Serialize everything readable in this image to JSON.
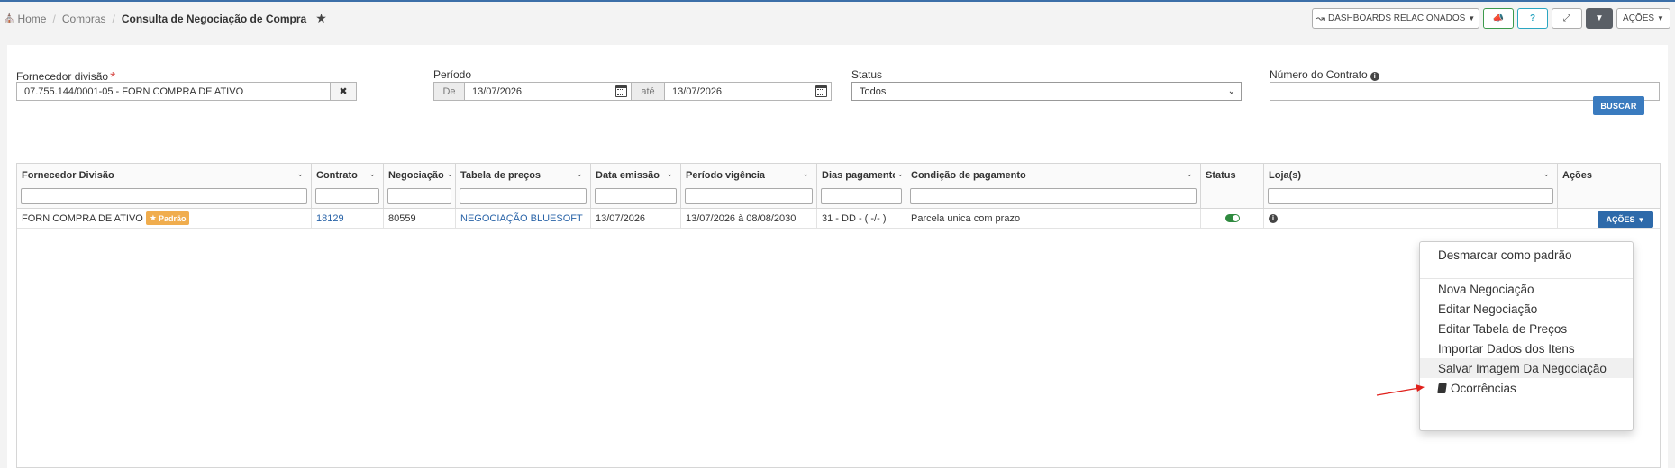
{
  "breadcrumb": {
    "home": "Home",
    "section": "Compras",
    "current": "Consulta de Negociação de Compra"
  },
  "header_buttons": {
    "dashboards": "DASHBOARDS RELACIONADOS",
    "acoes": "AÇÕES"
  },
  "filters": {
    "fornecedor_label": "Fornecedor divisão",
    "fornecedor_value": "07.755.144/0001-05 - FORN COMPRA DE ATIVO",
    "periodo_label": "Período",
    "de_label": "De",
    "de_value": "13/07/2026",
    "ate_label": "até",
    "ate_value": "13/07/2026",
    "status_label": "Status",
    "status_value": "Todos",
    "contrato_label": "Número do Contrato",
    "contrato_value": "",
    "buscar": "BUSCAR"
  },
  "table": {
    "columns": [
      "Fornecedor Divisão",
      "Contrato",
      "Negociação",
      "Tabela de preços",
      "Data emissão",
      "Período vigência",
      "Dias pagamento",
      "Condição de pagamento",
      "Status",
      "Loja(s)",
      "Ações"
    ],
    "row": {
      "fornecedor": "FORN COMPRA DE ATIVO",
      "badge": "Padrão",
      "contrato": "18129",
      "negociacao": "80559",
      "tabela": "NEGOCIAÇÃO BLUESOFT",
      "data_emissao": "13/07/2026",
      "periodo": "13/07/2026 à 08/08/2030",
      "dias": "31 - DD - ( -/- )",
      "condicao": "Parcela unica com prazo",
      "acoes": "AÇÕES"
    }
  },
  "menu": {
    "items": [
      "Desmarcar como padrão",
      "Nova Negociação",
      "Editar Negociação",
      "Editar Tabela de Preços",
      "Importar Dados dos Itens",
      "Salvar Imagem Da Negociação",
      "Ocorrências"
    ]
  },
  "colors": {
    "primary": "#3a7bbf",
    "badge": "#f0ad4e",
    "toggle": "#2f8a3f",
    "arrow": "#e0201b"
  }
}
